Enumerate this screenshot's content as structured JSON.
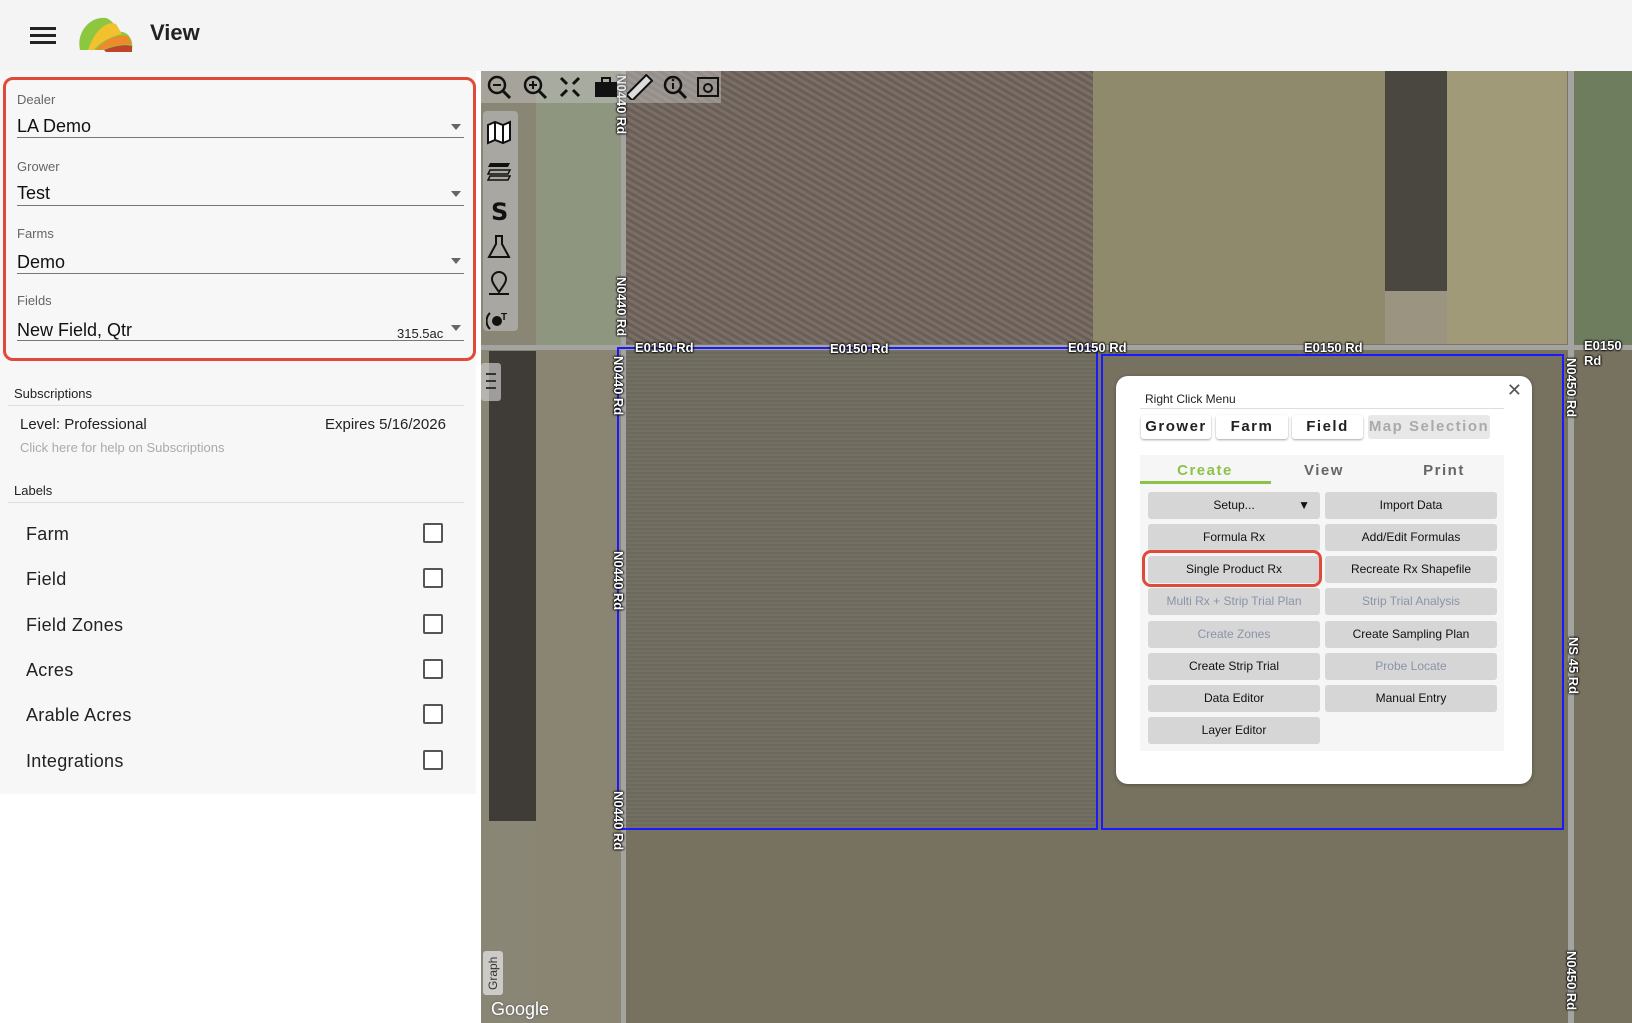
{
  "header": {
    "title": "View",
    "menu_icon": "hamburger-icon",
    "logo": "app-logo"
  },
  "selectors": [
    {
      "label": "Dealer",
      "value": "LA Demo"
    },
    {
      "label": "Grower",
      "value": "Test"
    },
    {
      "label": "Farms",
      "value": "Demo"
    },
    {
      "label": "Fields",
      "value": "New Field, Qtr",
      "acres": "315.5ac"
    }
  ],
  "subscriptions": {
    "title": "Subscriptions",
    "level": "Level: Professional",
    "expires": "Expires 5/16/2026",
    "help": "Click here for help on Subscriptions"
  },
  "labels": {
    "title": "Labels",
    "items": [
      {
        "label": "Farm",
        "checked": false
      },
      {
        "label": "Field",
        "checked": false
      },
      {
        "label": "Field Zones",
        "checked": false
      },
      {
        "label": "Acres",
        "checked": false
      },
      {
        "label": "Arable Acres",
        "checked": false
      },
      {
        "label": "Integrations",
        "checked": false
      }
    ]
  },
  "map": {
    "toolbar": [
      "zoom-out-icon",
      "zoom-in-icon",
      "fit-extent-icon",
      "briefcase-icon",
      "ruler-icon",
      "info-search-icon",
      "screenshot-icon"
    ],
    "side_tools": [
      "map-icon",
      "layers-icon",
      "soil-icon",
      "lab-flask-icon",
      "sampling-location-icon",
      "iot-sensor-icon"
    ],
    "graph_tab": "Graph",
    "attribution": "Google",
    "roads": {
      "n0440": "N0440 Rd",
      "e0150": "E0150 Rd",
      "n0450": "N0450 Rd",
      "ns45": "NS 45 Rd"
    },
    "boundary_color": "#1a1aff"
  },
  "popup": {
    "title": "Right Click Menu",
    "scope_tabs": [
      {
        "label": "Grower"
      },
      {
        "label": "Farm"
      },
      {
        "label": "Field"
      },
      {
        "label": "Map Selection",
        "disabled": true
      }
    ],
    "sub_tabs": [
      "Create",
      "View",
      "Print"
    ],
    "active_sub_tab": "Create",
    "buttons": [
      {
        "label": "Setup...",
        "arrow": "▼"
      },
      {
        "label": "Import Data"
      },
      {
        "label": "Formula Rx"
      },
      {
        "label": "Add/Edit Formulas"
      },
      {
        "label": "Single Product Rx"
      },
      {
        "label": "Recreate Rx Shapefile"
      },
      {
        "label": "Multi Rx + Strip Trial Plan",
        "disabled": true
      },
      {
        "label": "Strip Trial Analysis",
        "disabled": true
      },
      {
        "label": "Create Zones",
        "disabled": true
      },
      {
        "label": "Create Sampling Plan"
      },
      {
        "label": "Create Strip Trial"
      },
      {
        "label": "Probe Locate",
        "disabled": true
      },
      {
        "label": "Data Editor"
      },
      {
        "label": "Manual Entry"
      },
      {
        "label": "Layer Editor"
      }
    ]
  },
  "colors": {
    "accent": "#8bc34a",
    "highlight": "#e04a3a"
  }
}
